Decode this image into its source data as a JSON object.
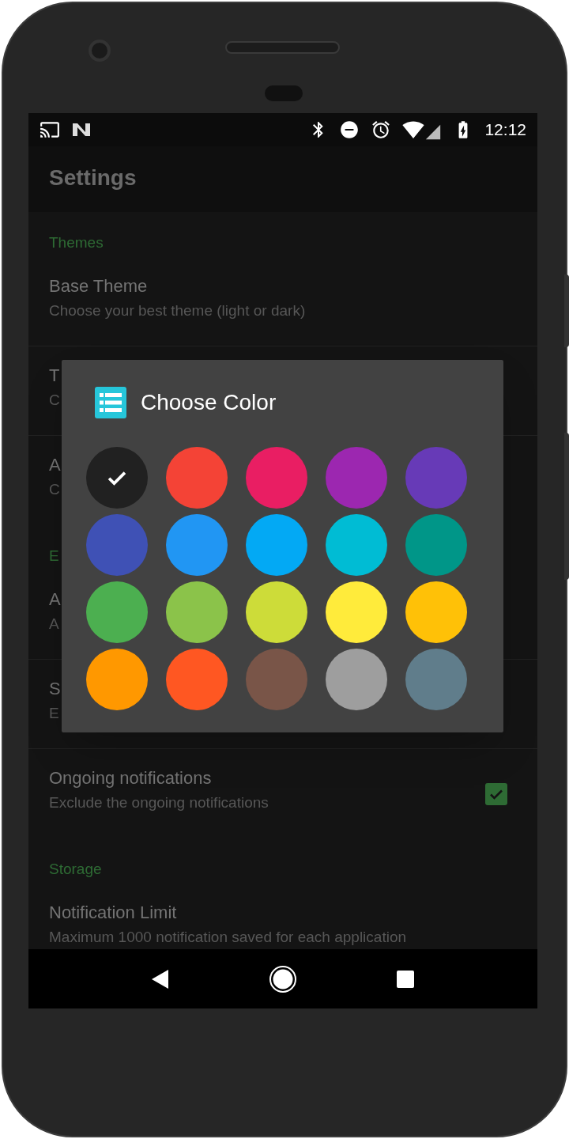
{
  "status_bar": {
    "time": "12:12"
  },
  "toolbar": {
    "title": "Settings"
  },
  "settings": [
    {
      "kind": "header",
      "label": "Themes"
    },
    {
      "kind": "item",
      "title": "Base Theme",
      "subtitle": "Choose your best theme (light or dark)"
    },
    {
      "kind": "item",
      "title": "T",
      "subtitle": "C"
    },
    {
      "kind": "item",
      "title": "A",
      "subtitle": "C"
    },
    {
      "kind": "header",
      "label": "E"
    },
    {
      "kind": "item",
      "title": "A",
      "subtitle": "A"
    },
    {
      "kind": "item",
      "title": "S",
      "subtitle": "E"
    },
    {
      "kind": "item",
      "title": "Ongoing notifications",
      "subtitle": "Exclude the ongoing notifications",
      "checked": true
    },
    {
      "kind": "header",
      "label": "Storage"
    },
    {
      "kind": "item",
      "title": "Notification Limit",
      "subtitle": "Maximum 1000 notification saved for each application"
    }
  ],
  "dialog": {
    "title": "Choose Color",
    "colors": [
      {
        "color": "#212121",
        "selected": true
      },
      {
        "color": "#f44336",
        "selected": false
      },
      {
        "color": "#e91e63",
        "selected": false
      },
      {
        "color": "#9c27b0",
        "selected": false
      },
      {
        "color": "#673ab7",
        "selected": false
      },
      {
        "color": "#3f51b5",
        "selected": false
      },
      {
        "color": "#2196f3",
        "selected": false
      },
      {
        "color": "#03a9f4",
        "selected": false
      },
      {
        "color": "#00bcd4",
        "selected": false
      },
      {
        "color": "#009688",
        "selected": false
      },
      {
        "color": "#4caf50",
        "selected": false
      },
      {
        "color": "#8bc34a",
        "selected": false
      },
      {
        "color": "#cddc39",
        "selected": false
      },
      {
        "color": "#ffeb3b",
        "selected": false
      },
      {
        "color": "#ffc107",
        "selected": false
      },
      {
        "color": "#ff9800",
        "selected": false
      },
      {
        "color": "#ff5722",
        "selected": false
      },
      {
        "color": "#795548",
        "selected": false
      },
      {
        "color": "#9e9e9e",
        "selected": false
      },
      {
        "color": "#607d8b",
        "selected": false
      }
    ]
  }
}
